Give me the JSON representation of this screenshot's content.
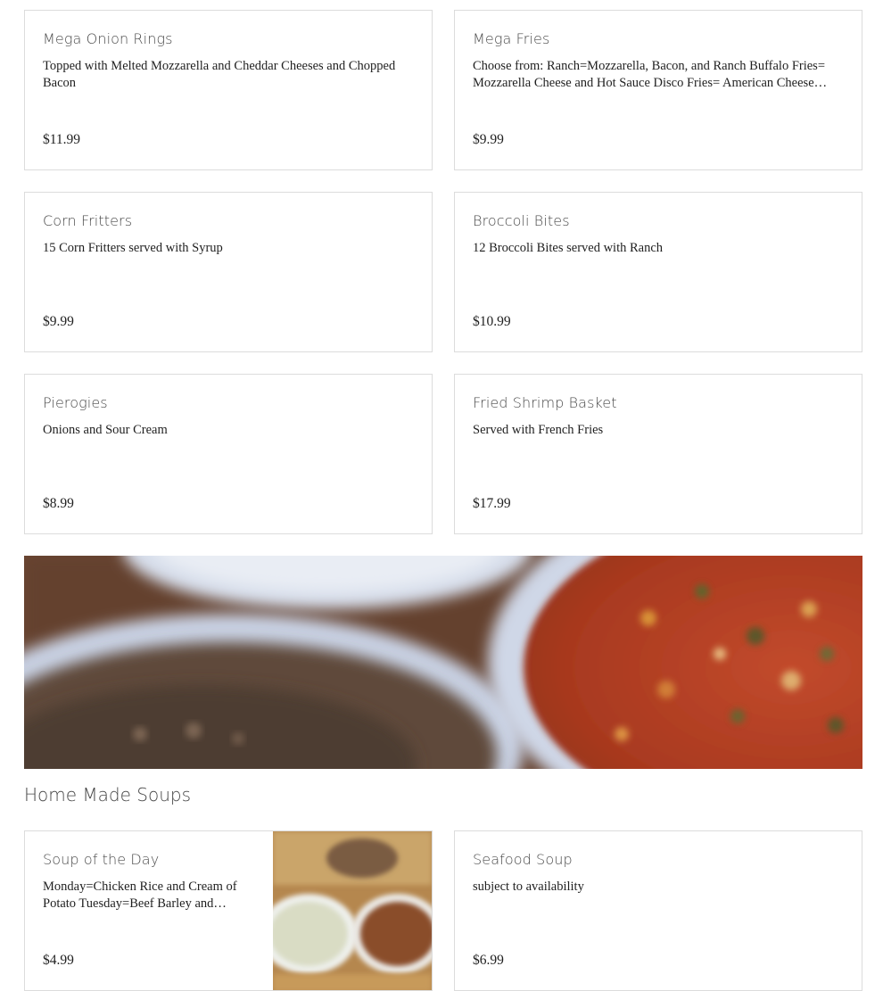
{
  "menu_items": [
    {
      "name": "Mega Onion Rings",
      "description": "Topped with Melted Mozzarella and Cheddar Cheeses and Chopped Bacon",
      "price": "$11.99"
    },
    {
      "name": "Mega Fries",
      "description": "Choose from: Ranch=Mozzarella, Bacon, and Ranch Buffalo Fries= Mozzarella Cheese and Hot Sauce Disco Fries= American Cheese and…",
      "price": "$9.99"
    },
    {
      "name": "Corn Fritters",
      "description": "15 Corn Fritters served with Syrup",
      "price": "$9.99"
    },
    {
      "name": "Broccoli Bites",
      "description": "12 Broccoli Bites served with Ranch",
      "price": "$10.99"
    },
    {
      "name": "Pierogies",
      "description": "Onions and Sour Cream",
      "price": "$8.99"
    },
    {
      "name": "Fried Shrimp Basket",
      "description": "Served with French Fries",
      "price": "$17.99"
    }
  ],
  "soups_section": {
    "title": "Home Made Soups",
    "items": [
      {
        "name": "Soup of the Day",
        "description": "Monday=Chicken Rice and Cream of Potato Tuesday=Beef Barley and Chick…",
        "price": "$4.99"
      },
      {
        "name": "Seafood Soup",
        "description": "subject to availability",
        "price": "$6.99"
      }
    ]
  },
  "colors": {
    "card_border": "#dcdcdc",
    "text_dark": "#1f1f1f",
    "title_gray": "#4a4a4a",
    "banner_brown": "#6a4a36",
    "banner_bowl": "#cdd5e6",
    "banner_soup_red": "#b8412a"
  },
  "images": {
    "banner": "soup-bowls-photo",
    "soup_thumb": "soup-cups-photo"
  }
}
